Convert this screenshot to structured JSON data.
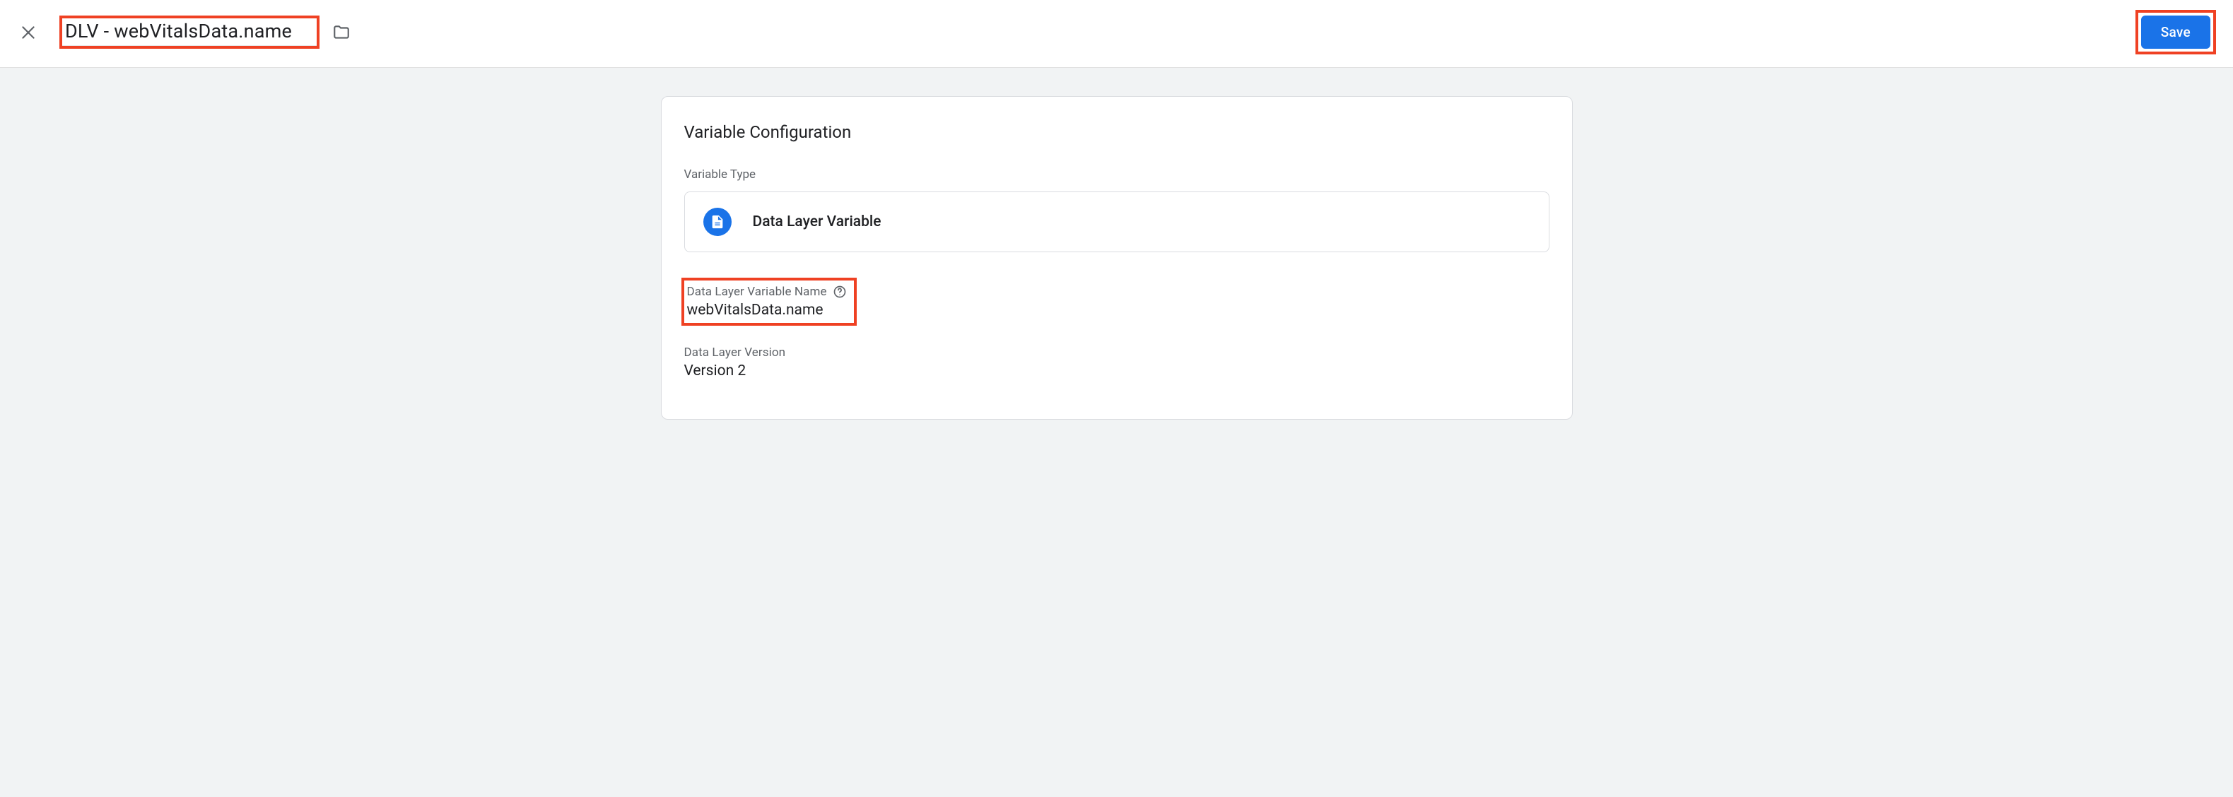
{
  "header": {
    "variable_name": "DLV - webVitalsData.name",
    "save_label": "Save"
  },
  "card": {
    "title": "Variable Configuration",
    "variable_type_section_label": "Variable Type",
    "variable_type_value": "Data Layer Variable",
    "dlv_name_label": "Data Layer Variable Name",
    "dlv_name_value": "webVitalsData.name",
    "dlv_version_label": "Data Layer Version",
    "dlv_version_value": "Version 2"
  }
}
